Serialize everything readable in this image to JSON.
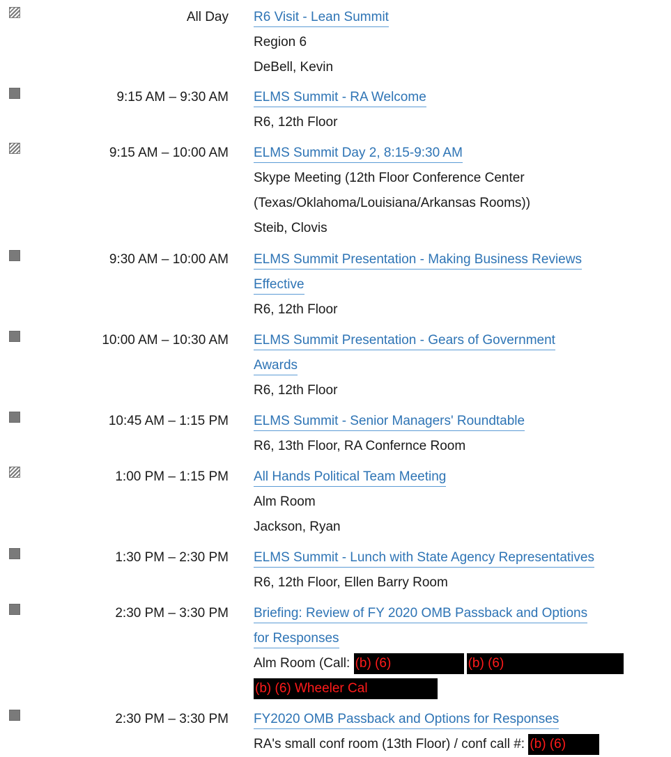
{
  "entries": [
    {
      "status": "tentative",
      "time": "All Day",
      "subject_lines": [
        "R6 Visit - Lean Summit"
      ],
      "details": [
        "Region 6",
        "DeBell, Kevin"
      ]
    },
    {
      "status": "busy",
      "time": "9:15 AM – 9:30 AM",
      "subject_lines": [
        "ELMS Summit - RA Welcome"
      ],
      "details": [
        "R6, 12th Floor"
      ]
    },
    {
      "status": "tentative",
      "time": "9:15 AM – 10:00 AM",
      "subject_lines": [
        "ELMS Summit Day 2, 8:15-9:30 AM"
      ],
      "details": [
        "Skype Meeting (12th Floor Conference Center",
        "(Texas/Oklahoma/Louisiana/Arkansas Rooms))",
        "Steib, Clovis"
      ]
    },
    {
      "status": "busy",
      "time": "9:30 AM – 10:00 AM",
      "subject_lines": [
        "ELMS Summit Presentation - Making Business Reviews",
        "Effective"
      ],
      "details": [
        "R6, 12th Floor"
      ]
    },
    {
      "status": "busy",
      "time": "10:00 AM – 10:30 AM",
      "subject_lines": [
        "ELMS Summit Presentation - Gears of Government",
        "Awards"
      ],
      "details": [
        "R6, 12th Floor"
      ]
    },
    {
      "status": "busy",
      "time": "10:45 AM – 1:15 PM",
      "subject_lines": [
        "ELMS Summit - Senior Managers' Roundtable"
      ],
      "details": [
        "R6, 13th Floor, RA Confernce Room"
      ]
    },
    {
      "status": "tentative",
      "time": "1:00 PM – 1:15 PM",
      "subject_lines": [
        "All Hands Political Team Meeting"
      ],
      "details": [
        "Alm Room",
        "Jackson, Ryan"
      ]
    },
    {
      "status": "busy",
      "time": "1:30 PM – 2:30 PM",
      "subject_lines": [
        "ELMS Summit - Lunch with State Agency Representatives"
      ],
      "details": [
        "R6, 12th Floor, Ellen Barry Room"
      ]
    },
    {
      "status": "busy",
      "time": "2:30 PM – 3:30 PM",
      "subject_lines": [
        "Briefing: Review of FY 2020 OMB Passback and Options",
        "for Responses"
      ],
      "details": [],
      "location_prefix": "Alm Room (Call: ",
      "redactions": [
        "(b) (6)",
        "(b) (6)",
        "(b) (6) Wheeler Cal"
      ]
    },
    {
      "status": "busy",
      "time": "2:30 PM – 3:30 PM",
      "subject_lines": [
        "FY2020 OMB Passback and Options for Responses"
      ],
      "details": [],
      "location_prefix": "RA's small conf room (13th Floor) / conf call #: ",
      "redactions": [
        "(b) (6)"
      ]
    }
  ]
}
